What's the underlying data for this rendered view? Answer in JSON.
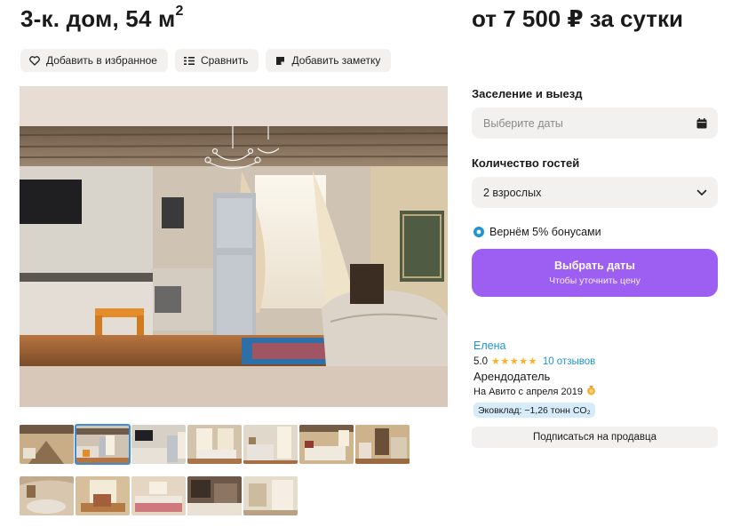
{
  "listing": {
    "title": "3-к. дом, 54 м",
    "title_sup": "2"
  },
  "actions": {
    "favorite": "Добавить в избранное",
    "compare": "Сравнить",
    "note": "Добавить заметку"
  },
  "icons": {
    "favorite": "heart-icon",
    "compare": "compare-icon",
    "note": "note-icon",
    "calendar": "calendar-icon",
    "chevron": "chevron-down-icon",
    "bonus": "bonus-badge-icon",
    "since": "medal-icon"
  },
  "booking": {
    "price": "от 7 500 ₽ за сутки",
    "checkin_label": "Заселение и выезд",
    "dates_placeholder": "Выберите даты",
    "guests_label": "Количество гостей",
    "guests_value": "2 взрослых",
    "bonus_text": "Вернём 5% бонусами",
    "cta_main": "Выбрать даты",
    "cta_sub": "Чтобы уточнить цену"
  },
  "seller": {
    "name": "Елена",
    "rating": "5.0",
    "stars": "★★★★★",
    "reviews": "10 отзывов",
    "role": "Арендодатель",
    "since": "На Авито с апреля 2019",
    "eco": "Эковклад: −1,26 тонн CO₂",
    "subscribe": "Подписаться на продавца"
  },
  "gallery": {
    "active_index": 1,
    "thumb_count": 12
  },
  "colors": {
    "accent": "#9d5ef2",
    "link": "#1e95d4",
    "chip_bg": "#f2f1f0",
    "star": "#ffb021",
    "eco_bg": "#d7ecfb"
  }
}
